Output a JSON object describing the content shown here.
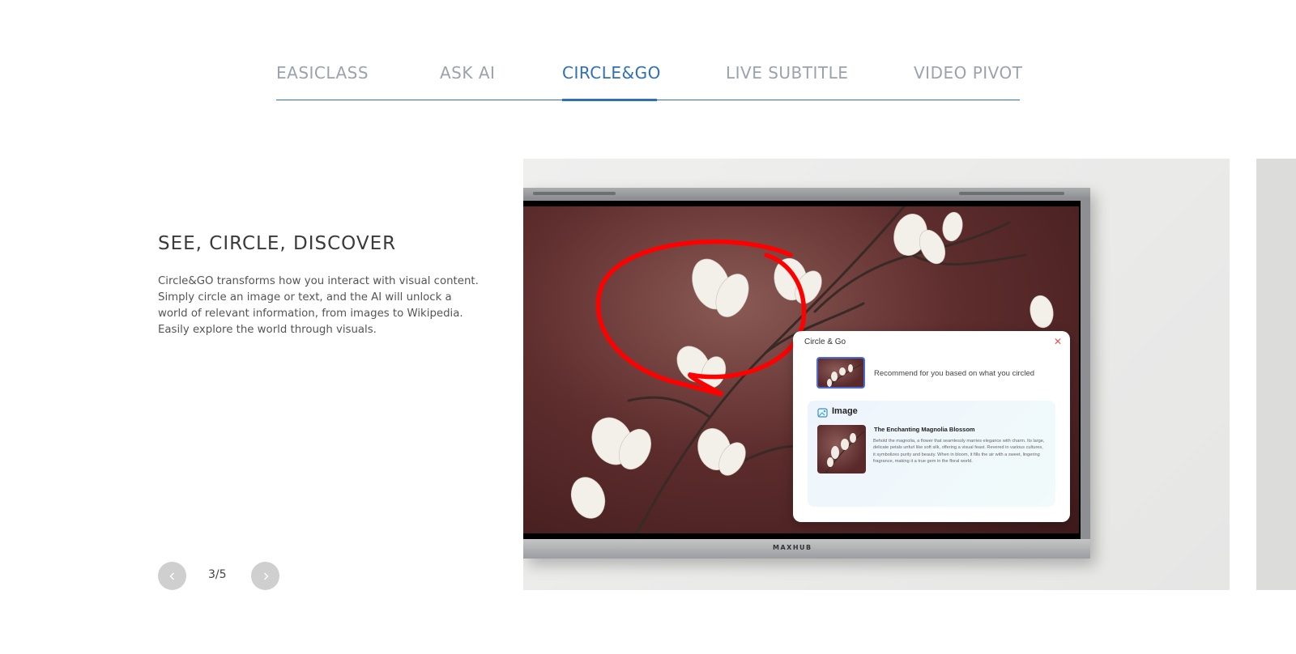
{
  "tabs": [
    {
      "label": "EASICLASS",
      "active": false
    },
    {
      "label": "ASK AI",
      "active": false
    },
    {
      "label": "CIRCLE&GO",
      "active": true
    },
    {
      "label": "LIVE SUBTITLE",
      "active": false
    },
    {
      "label": "VIDEO PIVOT",
      "active": false
    }
  ],
  "feature": {
    "heading": "SEE, CIRCLE, DISCOVER",
    "description": "Circle&GO transforms how you interact with visual content. Simply circle an image or text, and the AI will unlock a world of relevant information, from images to Wikipedia. Easily explore the world through visuals."
  },
  "pager": {
    "current": "3/5",
    "prev_icon": "chevron-left-icon",
    "next_icon": "chevron-right-icon"
  },
  "slide": {
    "brand": "MAXHUB",
    "popup": {
      "title": "Circle & Go",
      "close_icon": "close-icon",
      "recommend_text": "Recommend for you based on what you circled",
      "result_label": "Image",
      "result_title": "The Enchanting Magnolia Blossom",
      "result_body": "Behold the magnolia, a flower that seamlessly marries elegance with charm. Its large, delicate petals unfurl like soft silk, offering a visual feast. Revered in various cultures, it symbolizes purity and beauty. When in bloom, it fills the air with a sweet, lingering fragrance, making it a true gem in the floral world."
    }
  },
  "colors": {
    "accent": "#2f6fb3",
    "tab_inactive": "#9aa3ad",
    "circle_stroke": "#ff0000",
    "close": "#e4534a"
  }
}
